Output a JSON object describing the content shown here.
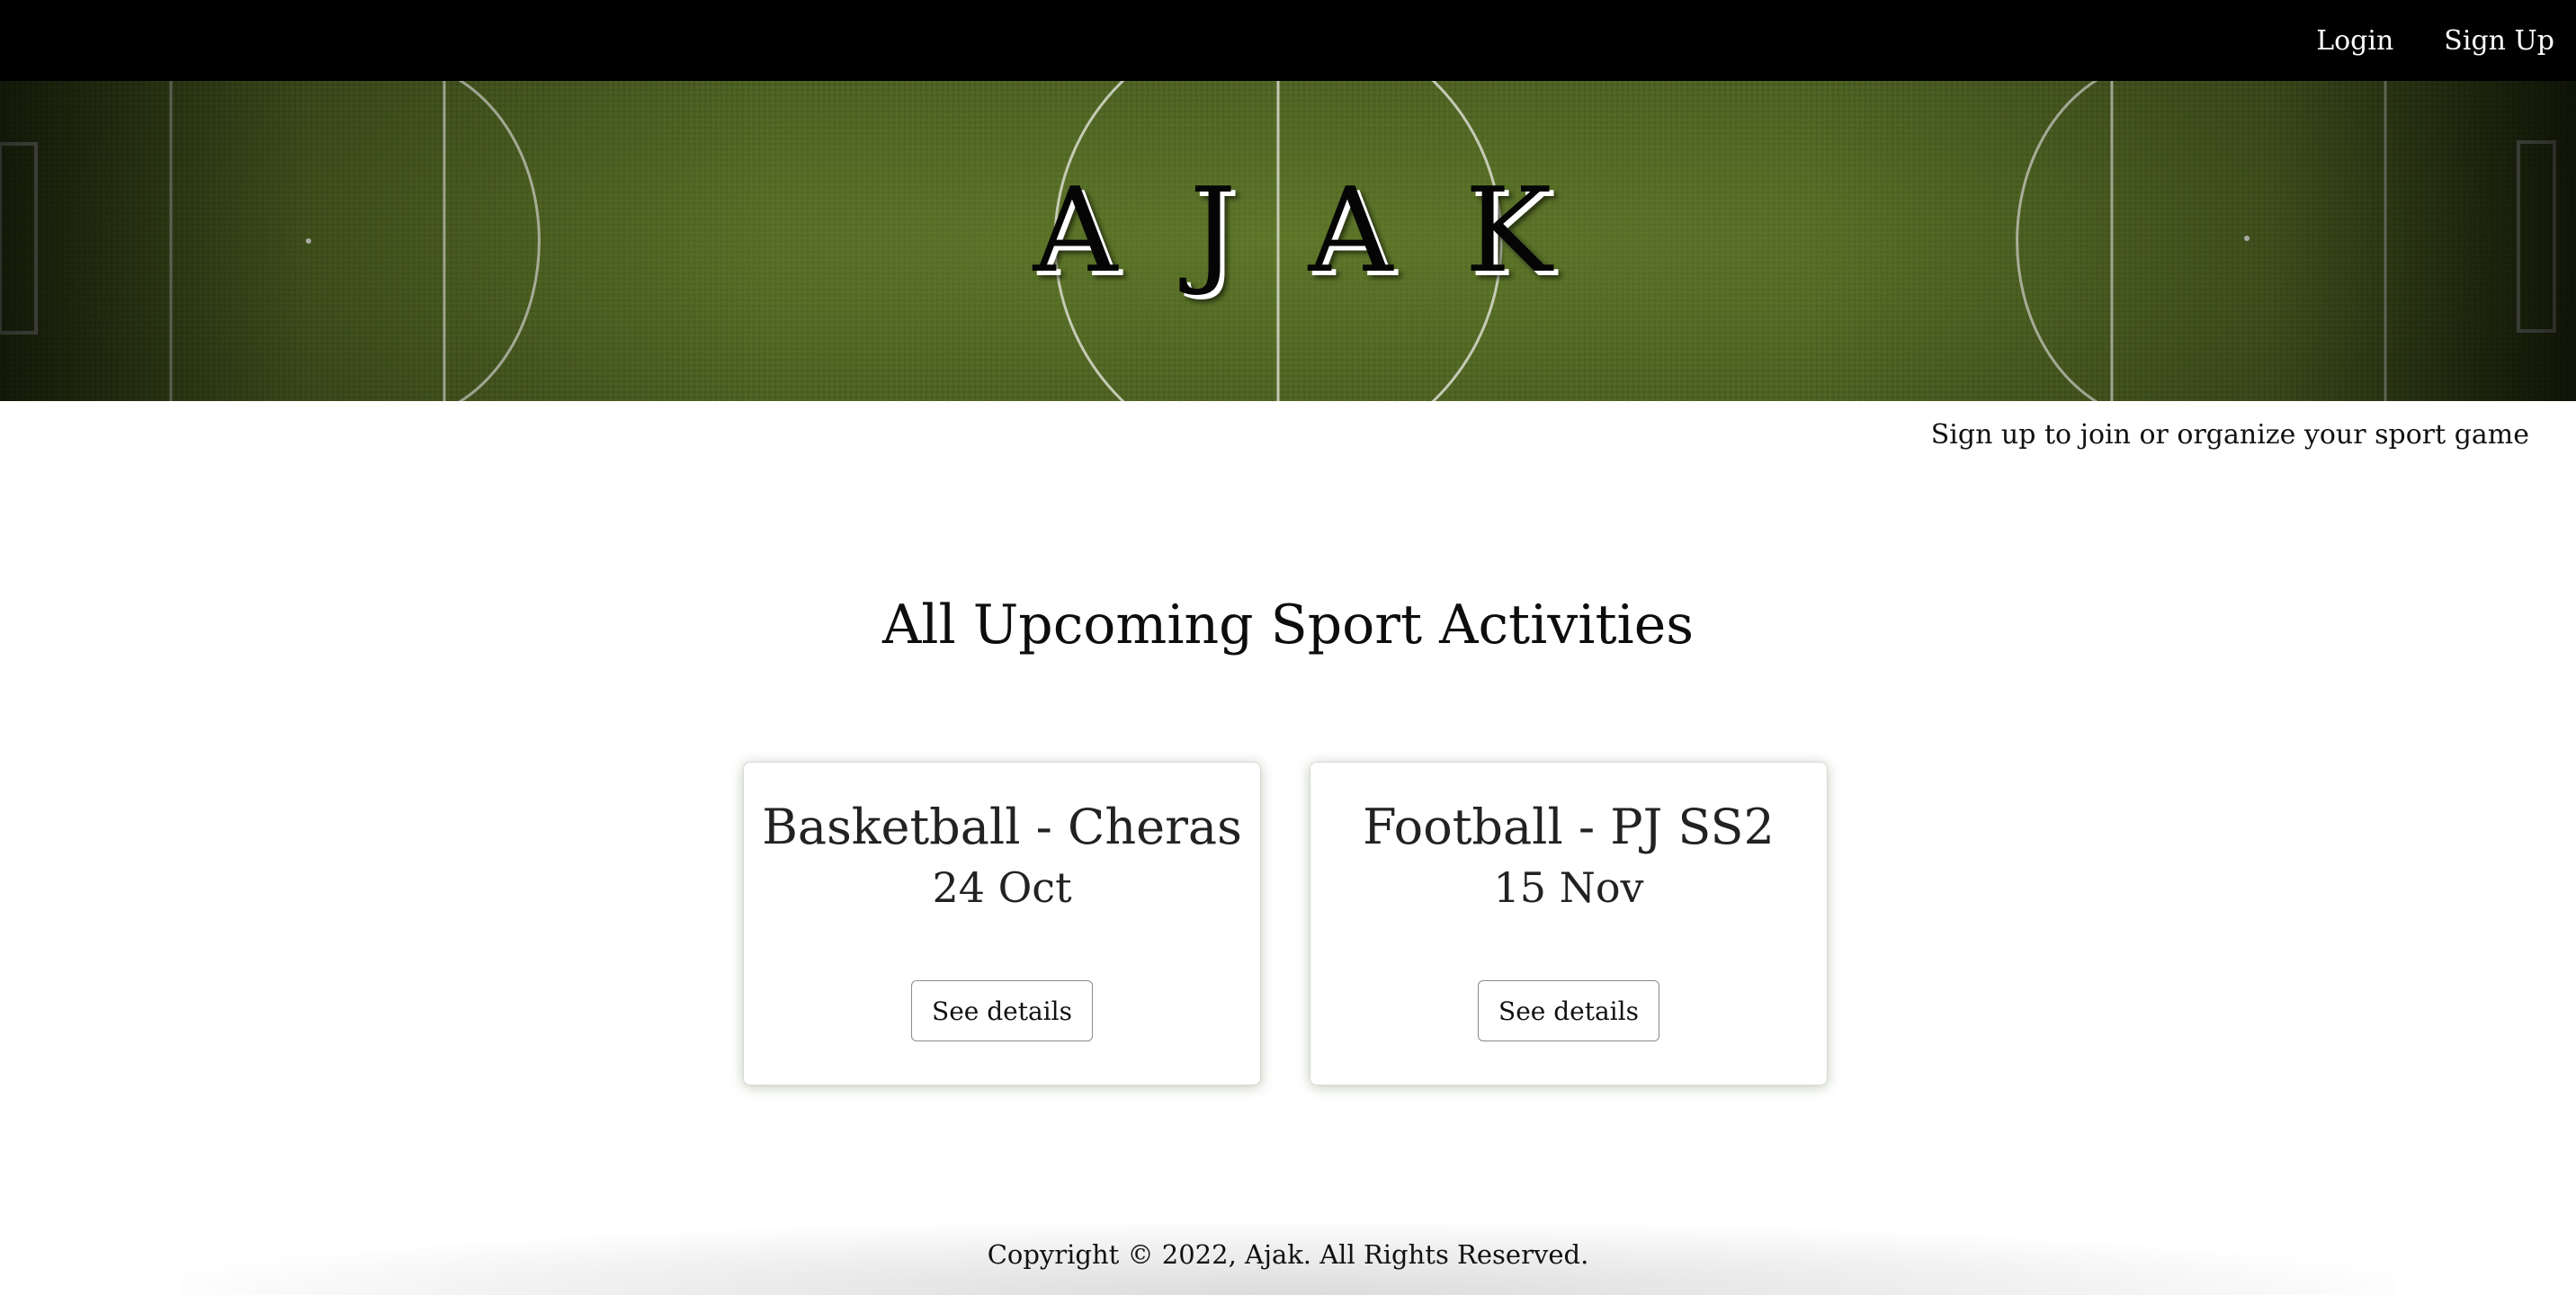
{
  "nav": {
    "login_label": "Login",
    "signup_label": "Sign Up"
  },
  "hero": {
    "brand_letters": [
      "A",
      "J",
      "A",
      "K"
    ],
    "background": "football-pitch-image"
  },
  "tagline": "Sign up to join or organize your sport game",
  "section": {
    "title": "All Upcoming Sport Activities"
  },
  "activities": [
    {
      "title": "Basketball - Cheras",
      "date": "24 Oct",
      "button_label": "See details"
    },
    {
      "title": "Football - PJ SS2",
      "date": "15 Nov",
      "button_label": "See details"
    }
  ],
  "footer": {
    "copyright": "Copyright © 2022, Ajak. All Rights Reserved."
  },
  "colors": {
    "navbar": "#000000",
    "pitch_green": "#4b6120",
    "card_shadow": "#6e8c50"
  }
}
